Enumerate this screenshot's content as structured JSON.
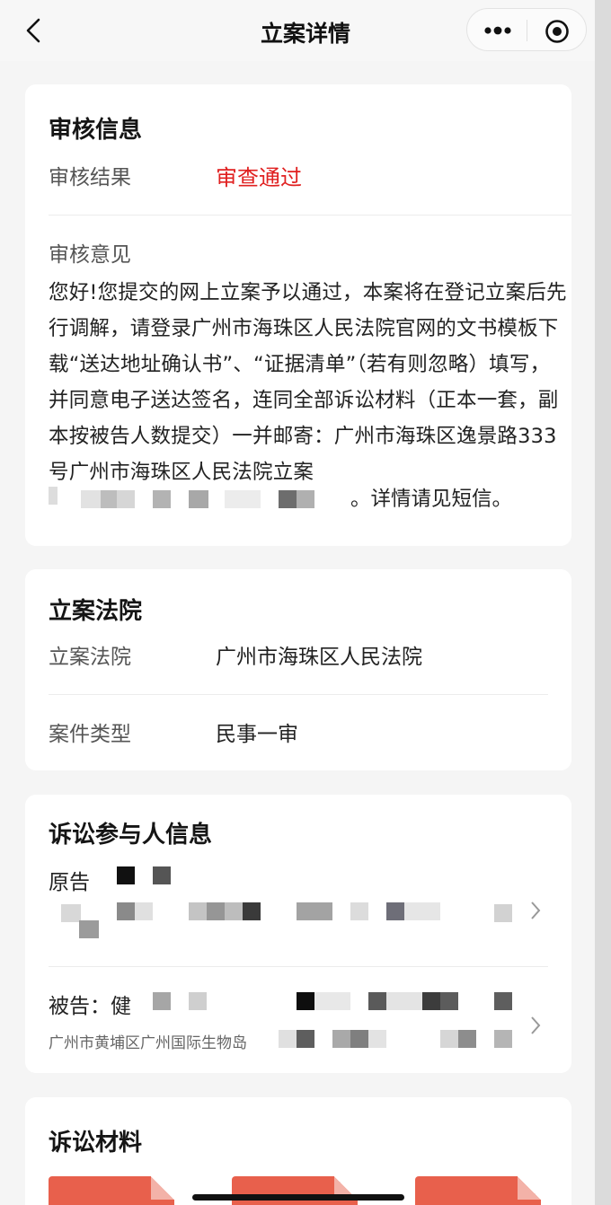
{
  "nav": {
    "title": "立案详情"
  },
  "review": {
    "section_title": "审核信息",
    "result_label": "审核结果",
    "result_value": "审查通过",
    "result_color": "#e02020",
    "opinion_label": "审核意见",
    "opinion_text": "您好!您提交的网上立案予以通过，本案将在登记立案后先行调解，请登录广州市海珠区人民法院官网的文书模板下载“送达地址确认书”、“证据清单”（若有则忽略）填写，并同意电子送达签名，连同全部诉讼材料（正本一套，副本按被告人数提交）一并邮寄：广州市海珠区逸景路333号广州市海珠区人民法院立案",
    "opinion_tail": "。详情请见短信。"
  },
  "court": {
    "section_title": "立案法院",
    "court_label": "立案法院",
    "court_value": "广州市海珠区人民法院",
    "type_label": "案件类型",
    "type_value": "民事一审"
  },
  "parties": {
    "section_title": "诉讼参与人信息",
    "plaintiff_label": "原告",
    "defendant_label": "被告：健",
    "defendant_address": "广州市黄埔区广州国际生物岛"
  },
  "materials": {
    "section_title": "诉讼材料"
  }
}
